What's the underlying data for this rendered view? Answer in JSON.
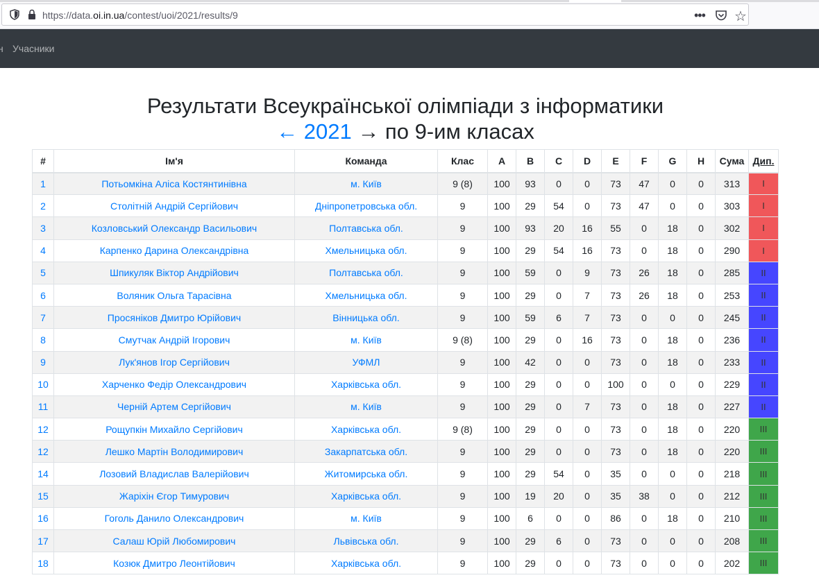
{
  "browser": {
    "url_prefix": "https://data.",
    "url_domain": "oi.in.ua",
    "url_path": "/contest/uoi/2021/results/9",
    "menu_icon": "dots-icon",
    "pocket_icon": "pocket-icon",
    "bookmark_icon": "star-icon"
  },
  "navbar": {
    "partial_item": "н",
    "item": "Учасники"
  },
  "heading": {
    "line1": "Результати Всеукраїнської олімпіади з інформатики",
    "prev_link": "← 2021",
    "line2_rest": " → по 9-им класах"
  },
  "table": {
    "headers": [
      "#",
      "Ім'я",
      "Команда",
      "Клас",
      "A",
      "B",
      "C",
      "D",
      "E",
      "F",
      "G",
      "H",
      "Сума",
      "Дип."
    ],
    "rows": [
      {
        "n": "1",
        "name": "Потьомкіна Аліса Костянтинівна",
        "team": "м. Київ",
        "cls": "9 (8)",
        "s": [
          "100",
          "93",
          "0",
          "0",
          "73",
          "47",
          "0",
          "0"
        ],
        "sum": "313",
        "dip": "I",
        "lvl": 1
      },
      {
        "n": "2",
        "name": "Столітній Андрій Сергійович",
        "team": "Дніпропетровська обл.",
        "cls": "9",
        "s": [
          "100",
          "29",
          "54",
          "0",
          "73",
          "47",
          "0",
          "0"
        ],
        "sum": "303",
        "dip": "I",
        "lvl": 1
      },
      {
        "n": "3",
        "name": "Козловський Олександр Васильович",
        "team": "Полтавська обл.",
        "cls": "9",
        "s": [
          "100",
          "93",
          "20",
          "16",
          "55",
          "0",
          "18",
          "0"
        ],
        "sum": "302",
        "dip": "I",
        "lvl": 1
      },
      {
        "n": "4",
        "name": "Карпенко Дарина Олександрівна",
        "team": "Хмельницька обл.",
        "cls": "9",
        "s": [
          "100",
          "29",
          "54",
          "16",
          "73",
          "0",
          "18",
          "0"
        ],
        "sum": "290",
        "dip": "I",
        "lvl": 1
      },
      {
        "n": "5",
        "name": "Шпикуляк Віктор Андрійович",
        "team": "Полтавська обл.",
        "cls": "9",
        "s": [
          "100",
          "59",
          "0",
          "9",
          "73",
          "26",
          "18",
          "0"
        ],
        "sum": "285",
        "dip": "II",
        "lvl": 2
      },
      {
        "n": "6",
        "name": "Воляник Ольга Тарасівна",
        "team": "Хмельницька обл.",
        "cls": "9",
        "s": [
          "100",
          "29",
          "0",
          "7",
          "73",
          "26",
          "18",
          "0"
        ],
        "sum": "253",
        "dip": "II",
        "lvl": 2
      },
      {
        "n": "7",
        "name": "Просяніков Дмитро Юрійович",
        "team": "Вінницька обл.",
        "cls": "9",
        "s": [
          "100",
          "59",
          "6",
          "7",
          "73",
          "0",
          "0",
          "0"
        ],
        "sum": "245",
        "dip": "II",
        "lvl": 2
      },
      {
        "n": "8",
        "name": "Смутчак Андрій Ігорович",
        "team": "м. Київ",
        "cls": "9 (8)",
        "s": [
          "100",
          "29",
          "0",
          "16",
          "73",
          "0",
          "18",
          "0"
        ],
        "sum": "236",
        "dip": "II",
        "lvl": 2
      },
      {
        "n": "9",
        "name": "Лук'янов Ігор Сергійович",
        "team": "УФМЛ",
        "cls": "9",
        "s": [
          "100",
          "42",
          "0",
          "0",
          "73",
          "0",
          "18",
          "0"
        ],
        "sum": "233",
        "dip": "II",
        "lvl": 2
      },
      {
        "n": "10",
        "name": "Харченко Федір Олександрович",
        "team": "Харківська обл.",
        "cls": "9",
        "s": [
          "100",
          "29",
          "0",
          "0",
          "100",
          "0",
          "0",
          "0"
        ],
        "sum": "229",
        "dip": "II",
        "lvl": 2
      },
      {
        "n": "11",
        "name": "Черній Артем Сергійович",
        "team": "м. Київ",
        "cls": "9",
        "s": [
          "100",
          "29",
          "0",
          "7",
          "73",
          "0",
          "18",
          "0"
        ],
        "sum": "227",
        "dip": "II",
        "lvl": 2
      },
      {
        "n": "12",
        "name": "Рощупкін Михайло Сергійович",
        "team": "Харківська обл.",
        "cls": "9 (8)",
        "s": [
          "100",
          "29",
          "0",
          "0",
          "73",
          "0",
          "18",
          "0"
        ],
        "sum": "220",
        "dip": "III",
        "lvl": 3
      },
      {
        "n": "12",
        "name": "Лешко Мартін Володимирович",
        "team": "Закарпатська обл.",
        "cls": "9",
        "s": [
          "100",
          "29",
          "0",
          "0",
          "73",
          "0",
          "18",
          "0"
        ],
        "sum": "220",
        "dip": "III",
        "lvl": 3
      },
      {
        "n": "14",
        "name": "Лозовий Владислав Валерійович",
        "team": "Житомирська обл.",
        "cls": "9",
        "s": [
          "100",
          "29",
          "54",
          "0",
          "35",
          "0",
          "0",
          "0"
        ],
        "sum": "218",
        "dip": "III",
        "lvl": 3
      },
      {
        "n": "15",
        "name": "Жаріхін Єгор Тимурович",
        "team": "Харківська обл.",
        "cls": "9",
        "s": [
          "100",
          "19",
          "20",
          "0",
          "35",
          "38",
          "0",
          "0"
        ],
        "sum": "212",
        "dip": "III",
        "lvl": 3
      },
      {
        "n": "16",
        "name": "Гоголь Данило Олександрович",
        "team": "м. Київ",
        "cls": "9",
        "s": [
          "100",
          "6",
          "0",
          "0",
          "86",
          "0",
          "18",
          "0"
        ],
        "sum": "210",
        "dip": "III",
        "lvl": 3
      },
      {
        "n": "17",
        "name": "Салаш Юрій Любомирович",
        "team": "Львівська обл.",
        "cls": "9",
        "s": [
          "100",
          "29",
          "6",
          "0",
          "73",
          "0",
          "0",
          "0"
        ],
        "sum": "208",
        "dip": "III",
        "lvl": 3
      },
      {
        "n": "18",
        "name": "Козюк Дмитро Леонтійович",
        "team": "Харківська обл.",
        "cls": "9",
        "s": [
          "100",
          "29",
          "0",
          "0",
          "73",
          "0",
          "0",
          "0"
        ],
        "sum": "202",
        "dip": "III",
        "lvl": 3
      }
    ]
  },
  "colors": {
    "dip_I": "#f0575a",
    "dip_II": "#4646ff",
    "dip_III": "#3fa64a",
    "link": "#007bff",
    "navbar": "#343a40"
  }
}
